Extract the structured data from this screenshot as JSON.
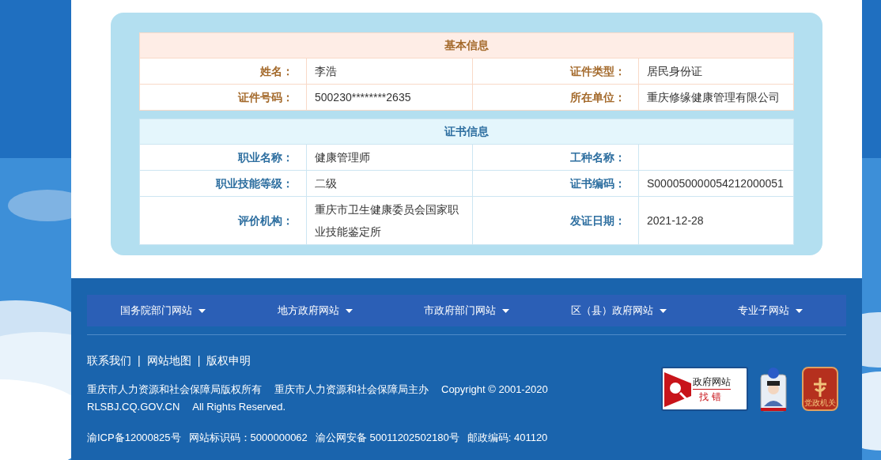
{
  "tables": [
    {
      "kind": "basic",
      "title": "基本信息",
      "rows": [
        [
          {
            "label": "姓名：",
            "value": "李浩"
          },
          {
            "label": "证件类型：",
            "value": "居民身份证"
          }
        ],
        [
          {
            "label": "证件号码：",
            "value": "500230********2635"
          },
          {
            "label": "所在单位：",
            "value": "重庆修缘健康管理有限公司"
          }
        ]
      ]
    },
    {
      "kind": "certificate",
      "title": "证书信息",
      "rows": [
        [
          {
            "label": "职业名称：",
            "value": "健康管理师"
          },
          {
            "label": "工种名称："
          }
        ],
        [
          {
            "label": "职业技能等级：",
            "value": "二级"
          },
          {
            "label": "证书编码：",
            "value": "S000050000054212000051"
          }
        ],
        [
          {
            "label": "评价机构：",
            "value": "重庆市卫生健康委员会国家职业技能鉴定所"
          },
          {
            "label": "发证日期：",
            "value": "2021-12-28"
          }
        ]
      ]
    }
  ],
  "footer": {
    "nav": [
      "国务院部门网站",
      "地方政府网站",
      "市政府部门网站",
      "区（县）政府网站",
      "专业子网站"
    ],
    "links": [
      "联系我们",
      "网站地图",
      "版权申明"
    ],
    "link_separator": "|",
    "copyright_lines": [
      [
        "重庆市人力资源和社会保障局版权所有",
        "重庆市人力资源和社会保障局主办",
        "Copyright © 2001-2020"
      ],
      [
        "RLSBJ.CQ.GOV.CN",
        "All Rights Reserved."
      ]
    ],
    "registration": [
      "渝ICP备12000825号",
      "网站标识码：5000000062",
      "渝公网安备 50011202502180号",
      "邮政编码: 401120"
    ],
    "error_badge": {
      "title": "政府网站",
      "action": "找错"
    },
    "emblem": "党政机关"
  }
}
